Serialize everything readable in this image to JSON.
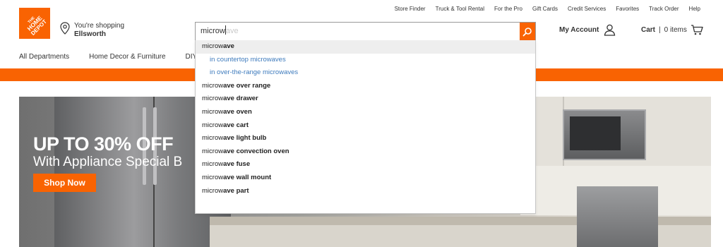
{
  "utility_links": [
    "Store Finder",
    "Truck & Tool Rental",
    "For the Pro",
    "Gift Cards",
    "Credit Services",
    "Favorites",
    "Track Order",
    "Help"
  ],
  "logo": {
    "text": "THE HOME DEPOT",
    "color": "#f96302"
  },
  "store": {
    "label": "You're shopping",
    "name": "Ellsworth",
    "icon": "location-pin-icon"
  },
  "search": {
    "typed": "microw",
    "suggestion_tail": "ave",
    "button_icon": "search-icon"
  },
  "account": {
    "label": "My Account",
    "icon": "user-icon"
  },
  "cart": {
    "label": "Cart",
    "separator": "|",
    "count": "0 items",
    "icon": "cart-icon"
  },
  "nav": [
    "All Departments",
    "Home Decor & Furniture",
    "DIY P"
  ],
  "hero": {
    "headline": "UP TO 30% OFF",
    "subline": "With Appliance Special B",
    "cta": "Shop Now"
  },
  "suggestions": [
    {
      "typed": "microw",
      "rest": "ave",
      "kind": "top"
    },
    {
      "text": "in countertop microwaves",
      "kind": "sub"
    },
    {
      "text": "in over-the-range microwaves",
      "kind": "sub"
    },
    {
      "typed": "microw",
      "rest": "ave over range",
      "kind": "item"
    },
    {
      "typed": "microw",
      "rest": "ave drawer",
      "kind": "item"
    },
    {
      "typed": "microw",
      "rest": "ave oven",
      "kind": "item"
    },
    {
      "typed": "microw",
      "rest": "ave cart",
      "kind": "item"
    },
    {
      "typed": "microw",
      "rest": "ave light bulb",
      "kind": "item"
    },
    {
      "typed": "microw",
      "rest": "ave convection oven",
      "kind": "item"
    },
    {
      "typed": "microw",
      "rest": "ave fuse",
      "kind": "item"
    },
    {
      "typed": "microw",
      "rest": "ave wall mount",
      "kind": "item"
    },
    {
      "typed": "microw",
      "rest": "ave part",
      "kind": "item"
    }
  ],
  "colors": {
    "brand": "#f96302",
    "link": "#3e7bbd",
    "highlight": "#eeeeee"
  }
}
